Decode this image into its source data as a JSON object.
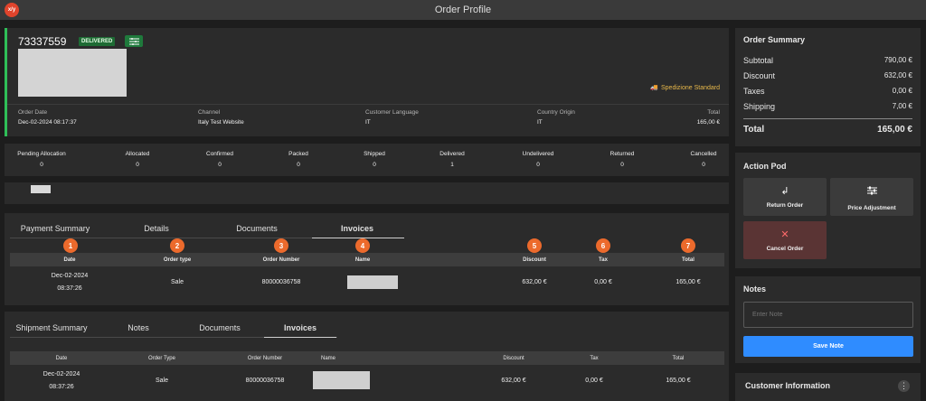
{
  "app": {
    "logo_text": "x/y",
    "title": "Order Profile"
  },
  "order": {
    "number": "73337559",
    "status_badge": "DELIVERED",
    "shipping_method": "Spedizione Standard",
    "fields": [
      {
        "label": "Order Date",
        "value": "Dec-02-2024 08:17:37"
      },
      {
        "label": "Channel",
        "value": "Italy Test Website"
      },
      {
        "label": "Customer Language",
        "value": "IT"
      },
      {
        "label": "Country Origin",
        "value": "IT"
      },
      {
        "label": "Total",
        "value": "165,00 €"
      }
    ]
  },
  "status_counts": [
    {
      "label": "Pending Allocation",
      "value": "0"
    },
    {
      "label": "Allocated",
      "value": "0"
    },
    {
      "label": "Confirmed",
      "value": "0"
    },
    {
      "label": "Packed",
      "value": "0"
    },
    {
      "label": "Shipped",
      "value": "0"
    },
    {
      "label": "Delivered",
      "value": "1"
    },
    {
      "label": "Undelivered",
      "value": "0"
    },
    {
      "label": "Returned",
      "value": "0"
    },
    {
      "label": "Cancelled",
      "value": "0"
    }
  ],
  "payment_tabs": [
    "Payment Summary",
    "Details",
    "Documents",
    "Invoices"
  ],
  "payment_table": {
    "badges": [
      "1",
      "2",
      "3",
      "4",
      "5",
      "6",
      "7"
    ],
    "headers": [
      "Date",
      "Order type",
      "Order Number",
      "Name",
      "Discount",
      "Tax",
      "Total"
    ],
    "row": {
      "date_line1": "Dec-02-2024",
      "date_line2": "08:37:26",
      "order_type": "Sale",
      "order_number": "80000036758",
      "discount": "632,00 €",
      "tax": "0,00 €",
      "total": "165,00 €"
    }
  },
  "shipment_tabs": [
    "Shipment Summary",
    "Notes",
    "Documents",
    "Invoices"
  ],
  "shipment_table": {
    "headers": [
      "Date",
      "Order Type",
      "Order Number",
      "Name",
      "Discount",
      "Tax",
      "Total"
    ],
    "row": {
      "date_line1": "Dec-02-2024",
      "date_line2": "08:37:26",
      "order_type": "Sale",
      "order_number": "80000036758",
      "discount": "632,00 €",
      "tax": "0,00 €",
      "total": "165,00 €"
    }
  },
  "order_summary": {
    "title": "Order Summary",
    "rows": [
      {
        "label": "Subtotal",
        "value": "790,00 €"
      },
      {
        "label": "Discount",
        "value": "632,00 €"
      },
      {
        "label": "Taxes",
        "value": "0,00 €"
      },
      {
        "label": "Shipping",
        "value": "7,00 €"
      }
    ],
    "total_label": "Total",
    "total_value": "165,00 €"
  },
  "action_pod": {
    "title": "Action Pod",
    "return_label": "Return Order",
    "price_label": "Price Adjustment",
    "cancel_label": "Cancel Order"
  },
  "notes": {
    "title": "Notes",
    "placeholder": "Enter Note",
    "save_label": "Save Note"
  },
  "customer": {
    "title": "Customer Information"
  },
  "colors": {
    "accent_green": "#2fbf58",
    "badge_orange": "#ec6a2c",
    "save_blue": "#2f8cff",
    "cancel_red": "#5a3434"
  }
}
